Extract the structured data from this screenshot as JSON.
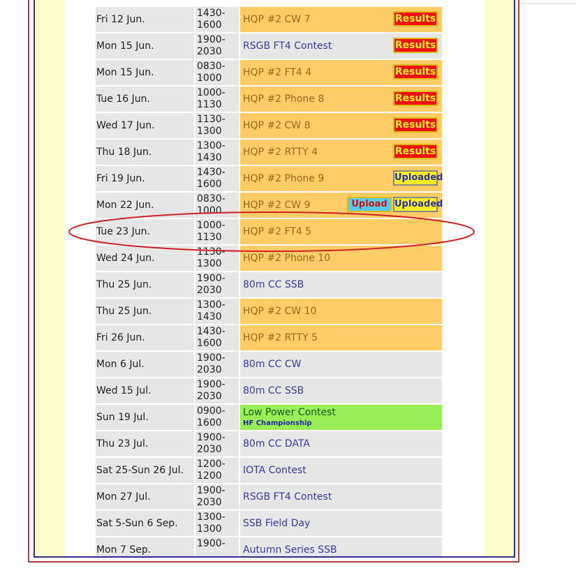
{
  "schedule": [
    {
      "date": "Fri 12 Jun.",
      "time": "1430-1600",
      "event": "HQP #2 CW 7",
      "style": "orange",
      "buttons": [
        "Results"
      ]
    },
    {
      "date": "Mon 15 Jun.",
      "time": "1900-2030",
      "event": "RSGB FT4 Contest",
      "style": "grey",
      "buttons": [
        "Results"
      ]
    },
    {
      "date": "Mon 15 Jun.",
      "time": "0830-1000",
      "event": "HQP #2 FT4 4",
      "style": "orange",
      "buttons": [
        "Results"
      ]
    },
    {
      "date": "Tue 16 Jun.",
      "time": "1000-1130",
      "event": "HQP #2 Phone 8",
      "style": "orange",
      "buttons": [
        "Results"
      ]
    },
    {
      "date": "Wed 17 Jun.",
      "time": "1130-1300",
      "event": "HQP #2 CW 8",
      "style": "orange",
      "buttons": [
        "Results"
      ]
    },
    {
      "date": "Thu 18 Jun.",
      "time": "1300-1430",
      "event": "HQP #2 RTTY 4",
      "style": "orange",
      "buttons": [
        "Results"
      ]
    },
    {
      "date": "Fri 19 Jun.",
      "time": "1430-1600",
      "event": "HQP #2 Phone 9",
      "style": "orange",
      "buttons": [
        "Uploaded"
      ]
    },
    {
      "date": "Mon 22 Jun.",
      "time": "0830-1000",
      "event": "HQP #2 CW 9",
      "style": "orange",
      "buttons": [
        "Upload",
        "Uploaded"
      ]
    },
    {
      "date": "Tue 23 Jun.",
      "time": "1000-1130",
      "event": "HQP #2 FT4 5",
      "style": "orange",
      "buttons": []
    },
    {
      "date": "Wed 24 Jun.",
      "time": "1130-1300",
      "event": "HQP #2 Phone 10",
      "style": "orange",
      "buttons": []
    },
    {
      "date": "Thu 25 Jun.",
      "time": "1900-2030",
      "event": "80m CC SSB",
      "style": "grey",
      "buttons": []
    },
    {
      "date": "Thu 25 Jun.",
      "time": "1300-1430",
      "event": "HQP #2 CW 10",
      "style": "orange",
      "buttons": []
    },
    {
      "date": "Fri 26 Jun.",
      "time": "1430-1600",
      "event": "HQP #2 RTTY 5",
      "style": "orange",
      "buttons": []
    },
    {
      "date": "Mon 6 Jul.",
      "time": "1900-2030",
      "event": "80m CC CW",
      "style": "grey",
      "buttons": []
    },
    {
      "date": "Wed 15 Jul.",
      "time": "1900-2030",
      "event": "80m CC SSB",
      "style": "grey",
      "buttons": []
    },
    {
      "date": "Sun 19 Jul.",
      "time": "0900-1600",
      "event": "Low Power Contest",
      "sub": "HF Championship",
      "style": "green",
      "buttons": []
    },
    {
      "date": "Thu 23 Jul.",
      "time": "1900-2030",
      "event": "80m CC DATA",
      "style": "grey",
      "buttons": []
    },
    {
      "date": "Sat 25-Sun 26 Jul.",
      "time": "1200-1200",
      "event": "IOTA Contest",
      "style": "grey",
      "buttons": []
    },
    {
      "date": "Mon 27 Jul.",
      "time": "1900-2030",
      "event": "RSGB FT4 Contest",
      "style": "grey",
      "buttons": []
    },
    {
      "date": "Sat 5-Sun 6 Sep.",
      "time": "1300-1300",
      "event": "SSB Field Day",
      "style": "grey",
      "buttons": []
    },
    {
      "date": "Mon 7 Sep.",
      "time": "1900-",
      "event": "Autumn Series SSB",
      "style": "grey",
      "buttons": []
    }
  ],
  "colors": {
    "highlight_ellipse": "#cc2222",
    "orange_row": "#ffcc66",
    "grey_row": "#e6e6e6",
    "green_row": "#99ee55"
  },
  "icons": {
    "scroll_down": "▾"
  }
}
